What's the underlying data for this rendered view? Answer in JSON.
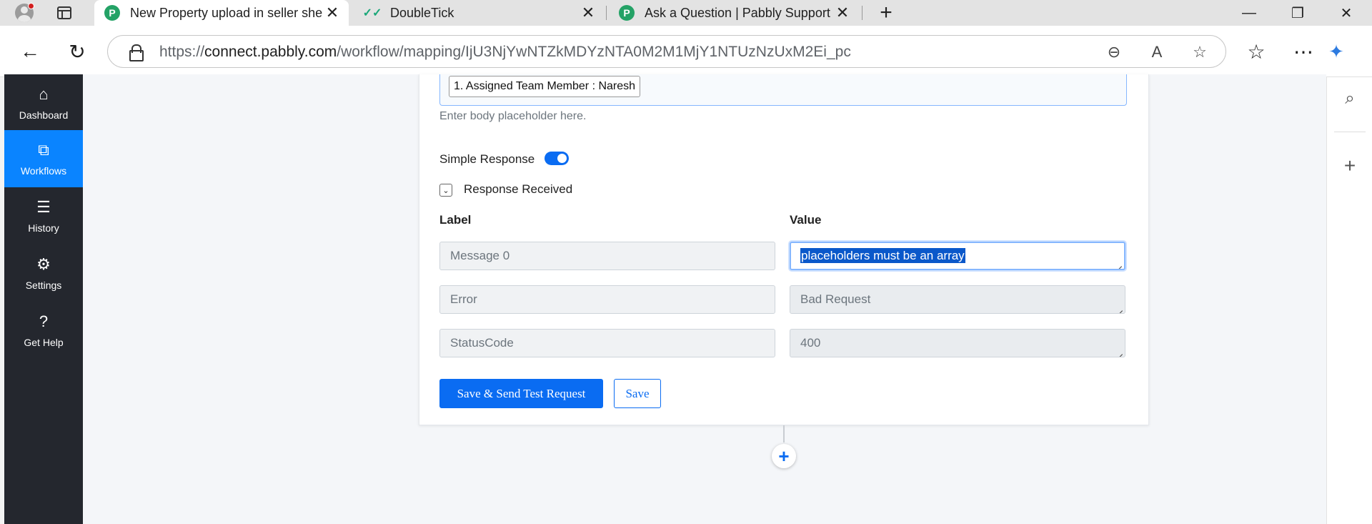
{
  "browser": {
    "tabs": [
      {
        "title": "New Property upload in seller she",
        "favicon": "pabbly-icon",
        "active": true
      },
      {
        "title": "DoubleTick",
        "favicon": "doubletick-icon",
        "active": false
      },
      {
        "title": "Ask a Question | Pabbly Support",
        "favicon": "pabbly-icon",
        "active": false
      }
    ],
    "url_prefix": "https://",
    "url_host": "connect.pabbly.com",
    "url_path": "/workflow/mapping/IjU3NjYwNTZkMDYzNTA0M2M1MjY1NTUzNzUxM2Ei_pc"
  },
  "app_nav": [
    {
      "label": "Dashboard",
      "icon": "home-icon",
      "active": false
    },
    {
      "label": "Workflows",
      "icon": "workflows-icon",
      "active": true
    },
    {
      "label": "History",
      "icon": "history-icon",
      "active": false
    },
    {
      "label": "Settings",
      "icon": "gear-icon",
      "active": false
    },
    {
      "label": "Get Help",
      "icon": "help-icon",
      "active": false
    }
  ],
  "step": {
    "body_chip": "1. Assigned Team Member : Naresh",
    "body_hint": "Enter body placeholder here.",
    "simple_response_label": "Simple Response",
    "simple_response_on": true,
    "response_received_label": "Response Received",
    "label_header": "Label",
    "value_header": "Value",
    "rows": [
      {
        "label": "Message 0",
        "value": "placeholders must be an array"
      },
      {
        "label": "Error",
        "value": "Bad Request"
      },
      {
        "label": "StatusCode",
        "value": "400"
      }
    ],
    "save_send_button": "Save & Send Test Request",
    "save_button": "Save"
  },
  "colors": {
    "accent": "#0a6cf2",
    "sidebar_bg": "#24272e",
    "sidebar_active": "#0a84ff"
  }
}
